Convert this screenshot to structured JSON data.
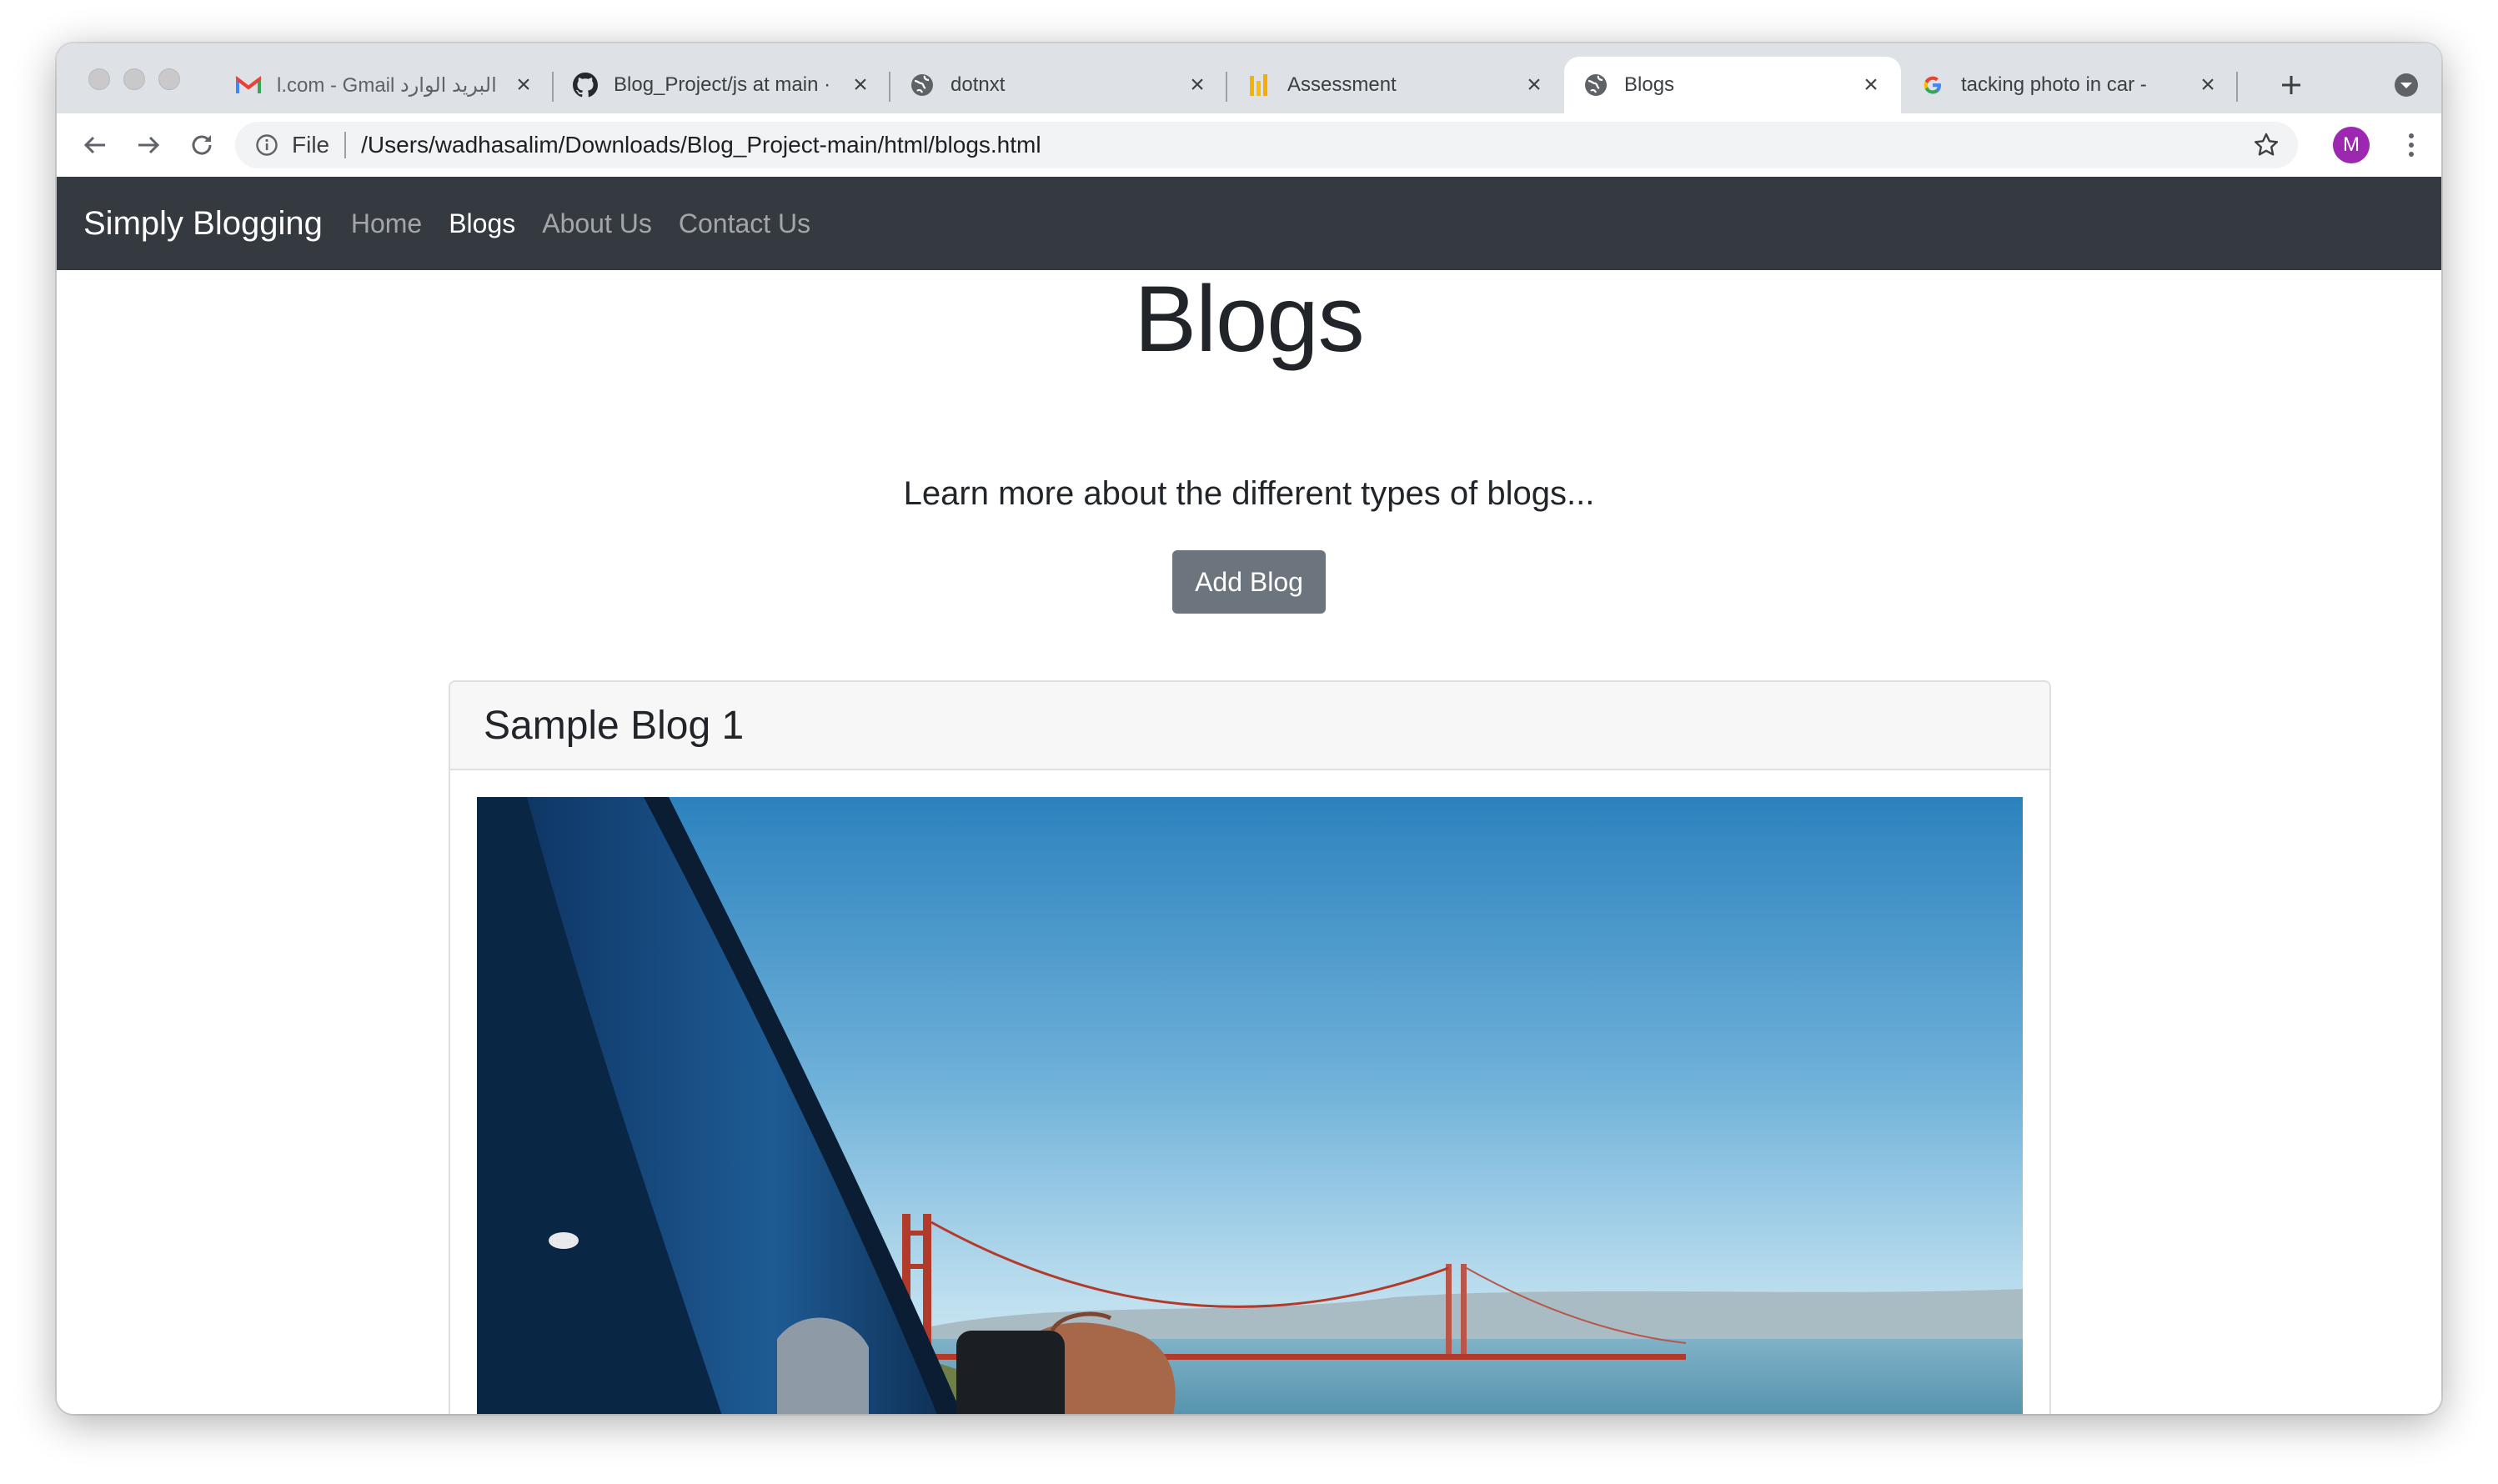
{
  "browser": {
    "tabs": [
      {
        "title": "l.com - Gmail البريد الوارد",
        "favicon": "gmail-icon",
        "active": false
      },
      {
        "title": "Blog_Project/js at main ·",
        "favicon": "github-icon",
        "active": false
      },
      {
        "title": "dotnxt",
        "favicon": "globe-icon",
        "active": false
      },
      {
        "title": "Assessment",
        "favicon": "assessment-icon",
        "active": false
      },
      {
        "title": "Blogs",
        "favicon": "globe-icon",
        "active": true
      },
      {
        "title": "tacking photo in car - ",
        "favicon": "google-icon",
        "active": false
      }
    ],
    "omnibox": {
      "scheme_label": "File",
      "url": "/Users/wadhasalim/Downloads/Blog_Project-main/html/blogs.html"
    },
    "profile_initial": "M"
  },
  "navbar": {
    "brand": "Simply Blogging",
    "links": [
      "Home",
      "Blogs",
      "About Us",
      "Contact Us"
    ],
    "active_link": "Blogs"
  },
  "hero": {
    "title": "Blogs",
    "lead": "Learn more about the different types of blogs...",
    "button": "Add Blog"
  },
  "blogs": [
    {
      "title": "Sample Blog 1",
      "image": "car-window-golden-gate-bridge-photo"
    }
  ],
  "colors": {
    "navbar_bg": "#343a40",
    "button_bg": "#6c757d",
    "avatar_bg": "#9c27b0",
    "tabstrip_bg": "#dee1e6"
  }
}
